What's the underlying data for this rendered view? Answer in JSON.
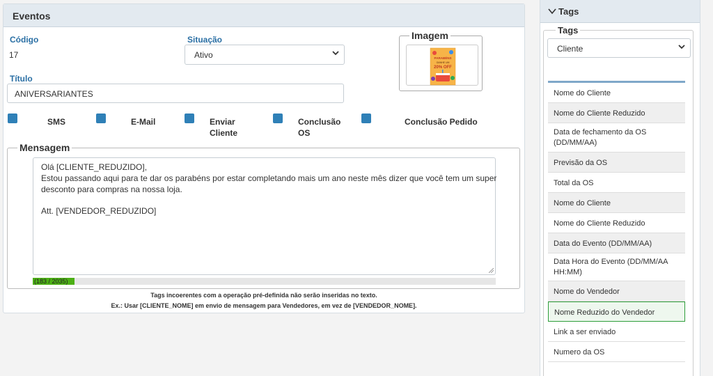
{
  "eventos": {
    "title": "Eventos",
    "codigo_label": "Código",
    "codigo_value": "17",
    "situacao_label": "Situação",
    "situacao_value": "Ativo",
    "imagem_label": "Imagem",
    "titulo_label": "Título",
    "titulo_value": "ANIVERSARIANTES",
    "checkboxes": [
      {
        "label_line1": "SMS",
        "label_line2": ""
      },
      {
        "label_line1": "E-Mail",
        "label_line2": ""
      },
      {
        "label_line1": "Enviar",
        "label_line2": "Cliente"
      },
      {
        "label_line1": "Conclusão",
        "label_line2": "OS"
      },
      {
        "label_line1": "Conclusão Pedido",
        "label_line2": ""
      }
    ],
    "mensagem_label": "Mensagem",
    "mensagem_lines": [
      "Olá [CLIENTE_REDUZIDO],",
      "Estou passando aqui para te dar os parabéns por estar completando mais um ano neste mês dizer que você tem um super",
      "desconto para compras na nossa loja.",
      "",
      "Att. [VENDEDOR_REDUZIDO]"
    ],
    "counter_text": "(183 / 2035)",
    "counter_fraction": 0.09,
    "note_line1": "Tags incoerentes com a operação pré-definida não serão inseridas no texto.",
    "note_line2": "Ex.: Usar [CLIENTE_NOME] em envio de mensagem para Vendedores, em vez de [VENDEDOR_NOME].",
    "image_text": {
      "line1": "PARABÉNS",
      "line2": "GANHE UM",
      "line3": "20% OFF"
    }
  },
  "tags": {
    "panel_title": "Tags",
    "fieldset_label": "Tags",
    "select_value": "Cliente",
    "items": [
      "Nome do Cliente",
      "Nome do Cliente Reduzido",
      "Data de fechamento da OS (DD/MM/AA)",
      "Previsão da OS",
      "Total da OS",
      "Nome do Cliente",
      "Nome do Cliente Reduzido",
      "Data do Evento (DD/MM/AA)",
      "Data Hora do Evento (DD/MM/AA HH:MM)",
      "Nome do Vendedor",
      "Nome Reduzido do Vendedor",
      "Link a ser enviado",
      "Numero da OS"
    ]
  },
  "colors": {
    "accent": "#2f80b7",
    "label_blue": "#2a6fa4",
    "active_tag_border": "#2e9e3a",
    "progress": "#4caf15"
  }
}
